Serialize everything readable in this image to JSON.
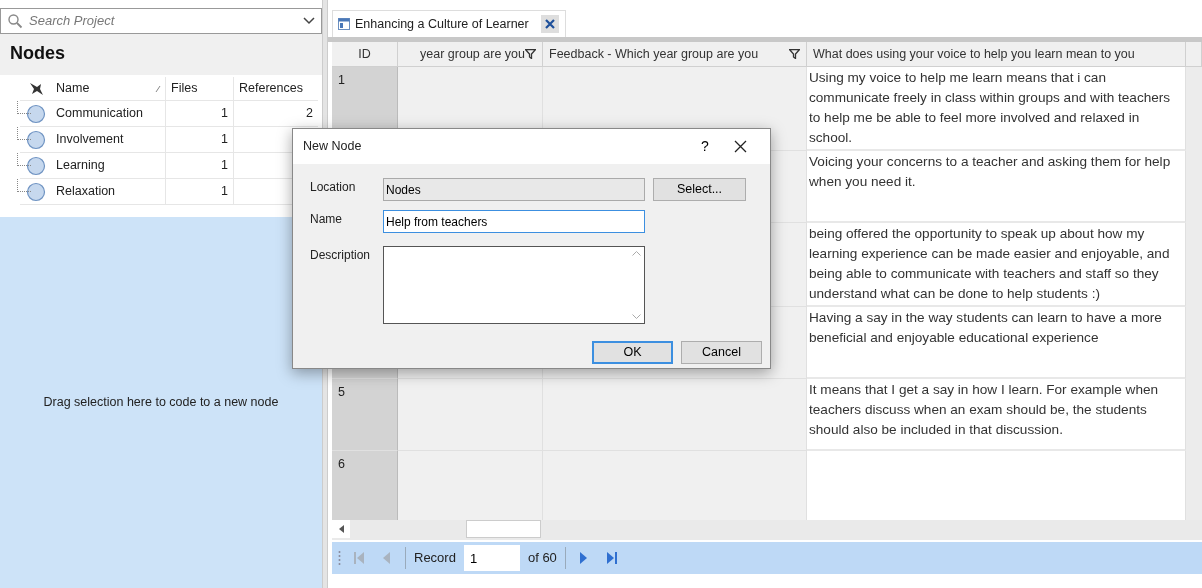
{
  "search": {
    "placeholder": "Search Project"
  },
  "nodes_panel": {
    "title": "Nodes",
    "columns": [
      "Name",
      "Files",
      "References"
    ],
    "rows": [
      {
        "name": "Communication",
        "files": "1",
        "references": "2"
      },
      {
        "name": "Involvement",
        "files": "1"
      },
      {
        "name": "Learning",
        "files": "1"
      },
      {
        "name": "Relaxation",
        "files": "1"
      }
    ],
    "drop_hint": "Drag selection here to code to a new node"
  },
  "document_tab": {
    "title": "Enhancing a Culture of Learner"
  },
  "grid": {
    "columns": [
      {
        "label": "ID",
        "filter": false
      },
      {
        "label": "year group are you",
        "filter": true
      },
      {
        "label": "Feedback - Which year group are you",
        "filter": true
      },
      {
        "label": "What does using your voice to help you learn mean to you",
        "filter": false
      }
    ],
    "rows": [
      {
        "id": "1",
        "response": "Using my voice to help me learn means that i can communicate freely in class within groups and with teachers to help me be able to feel more involved and relaxed in school."
      },
      {
        "response": "Voicing your concerns to a teacher and asking them for help when you need it."
      },
      {
        "response": "being offered the opportunity to speak up about how my learning experience can be made easier and enjoyable, and being able to communicate with teachers and staff so they understand what can be done to help students :)"
      },
      {
        "response": "Having a say in the way students can learn to have a more beneficial and enjoyable educational experience"
      },
      {
        "id": "5",
        "response": "It means that I get a say in how I learn. For example when teachers discuss when an exam should be, the students should also be included in that discussion."
      },
      {
        "id": "6"
      }
    ]
  },
  "record_nav": {
    "label": "Record",
    "value": "1",
    "total": "of 60",
    "buttons": [
      {
        "kind": "first",
        "disabled": true
      },
      {
        "kind": "previous",
        "disabled": true
      },
      {
        "kind": "next",
        "disabled": false
      },
      {
        "kind": "last",
        "disabled": false
      }
    ]
  },
  "dialog": {
    "title": "New Node",
    "help": "?",
    "fields": [
      {
        "label": "Location",
        "kind": "readonly",
        "value": "Nodes",
        "button": "Select..."
      },
      {
        "label": "Name",
        "kind": "text",
        "value": "Help from teachers",
        "focused": true
      },
      {
        "label": "Description",
        "kind": "textarea"
      }
    ],
    "buttons": [
      {
        "label": "OK",
        "default": true
      },
      {
        "label": "Cancel",
        "default": false
      }
    ]
  }
}
